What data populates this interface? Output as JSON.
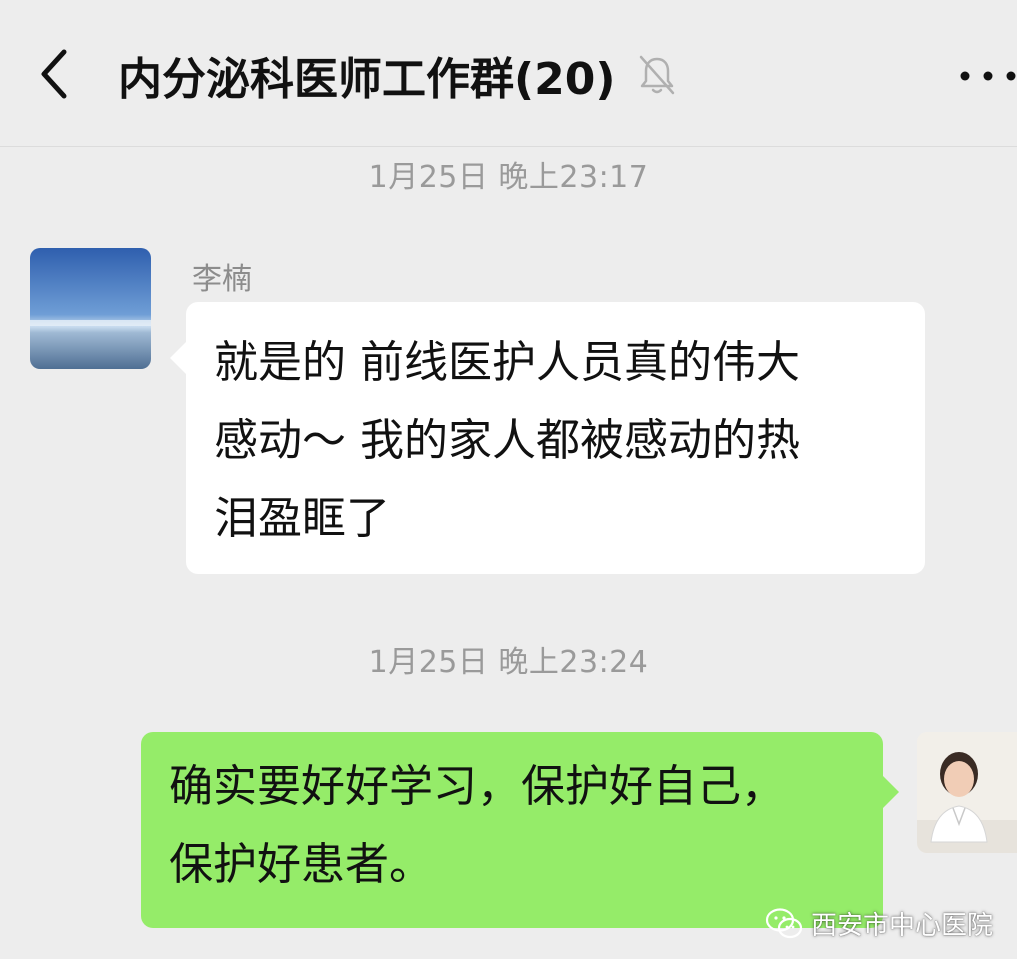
{
  "header": {
    "title": "内分泌科医师工作群(20)",
    "back_icon": "chevron-left-icon",
    "mute_icon": "bell-off-icon",
    "more_icon": "more-dots-icon"
  },
  "messages": [
    {
      "timestamp": "1月25日 晚上23:17",
      "sender": "李楠",
      "lines": [
        "就是的 前线医护人员真的伟大",
        "感动～ 我的家人都被感动的热",
        "泪盈眶了"
      ],
      "side": "left"
    },
    {
      "timestamp": "1月25日 晚上23:24",
      "lines": [
        "确实要好好学习，保护好自己，",
        "保护好患者。"
      ],
      "side": "right"
    }
  ],
  "watermark": {
    "text": "西安市中心医院",
    "icon": "wechat-icon"
  },
  "colors": {
    "background": "#ededed",
    "incoming_bubble": "#ffffff",
    "outgoing_bubble": "#95ec69",
    "timestamp_text": "#9a9a9a"
  }
}
